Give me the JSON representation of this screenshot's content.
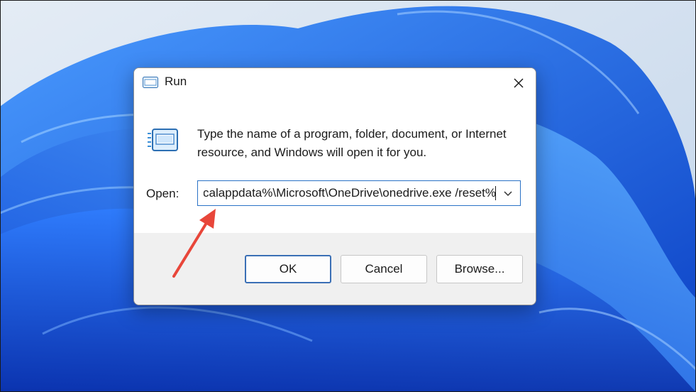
{
  "dialog": {
    "title": "Run",
    "description": "Type the name of a program, folder, document, or Internet resource, and Windows will open it for you.",
    "open_label": "Open:",
    "open_value": "%localappdata%\\Microsoft\\OneDrive\\onedrive.exe /reset",
    "buttons": {
      "ok": "OK",
      "cancel": "Cancel",
      "browse": "Browse..."
    }
  },
  "icons": {
    "title": "run-icon",
    "body": "run-icon",
    "close": "close-icon",
    "dropdown": "chevron-down-icon",
    "annotation": "red-arrow"
  },
  "colors": {
    "accent": "#2a72c6",
    "annotation": "#e8463a",
    "wallpaper_sky": "#d6e2f0",
    "wallpaper_blue": "#1f5ce0"
  }
}
